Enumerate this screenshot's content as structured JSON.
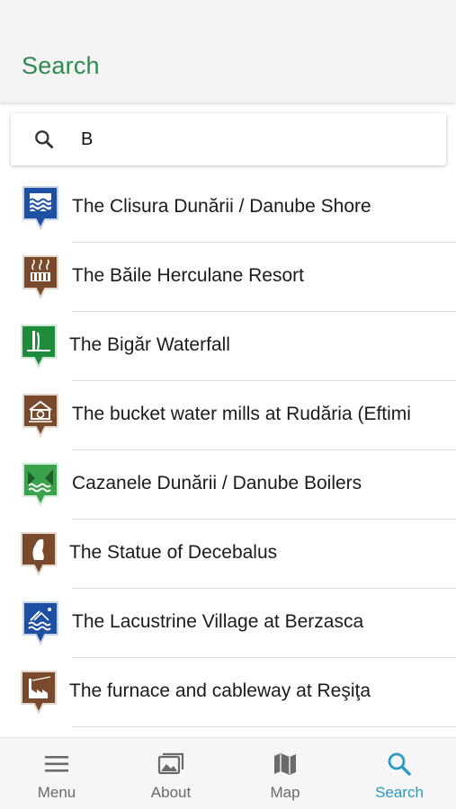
{
  "header": {
    "title": "Search"
  },
  "search": {
    "value": "B",
    "icon": "search-icon"
  },
  "results": [
    {
      "label": "The Clisura Dunării / Danube Shore",
      "icon": "water-waves-icon",
      "color": "#1d4fa3"
    },
    {
      "label": "The Băile Herculane Resort",
      "icon": "spa-resort-icon",
      "color": "#7a4a2c"
    },
    {
      "label": "The Bigăr Waterfall",
      "icon": "waterfall-icon",
      "color": "#1e8c3a"
    },
    {
      "label": "The bucket water mills at Rudăria (Eftimi",
      "icon": "water-mill-icon",
      "color": "#7a4a2c"
    },
    {
      "label": "Cazanele Dunării / Danube Boilers",
      "icon": "river-gorge-icon",
      "color": "#3aa24a"
    },
    {
      "label": "The Statue of Decebalus",
      "icon": "statue-icon",
      "color": "#7a4a2c"
    },
    {
      "label": "The Lacustrine Village at Berzasca",
      "icon": "lacustrine-village-icon",
      "color": "#1d4fa3"
    },
    {
      "label": "The furnace and cableway at Reşiţa",
      "icon": "factory-icon",
      "color": "#7a4a2c"
    }
  ],
  "nav": {
    "menu": "Menu",
    "about": "About",
    "map": "Map",
    "search": "Search",
    "active": "search",
    "active_color": "#2a9bc3",
    "inactive_color": "#6a6a6a"
  },
  "colors": {
    "title_green": "#2e8b4e"
  }
}
